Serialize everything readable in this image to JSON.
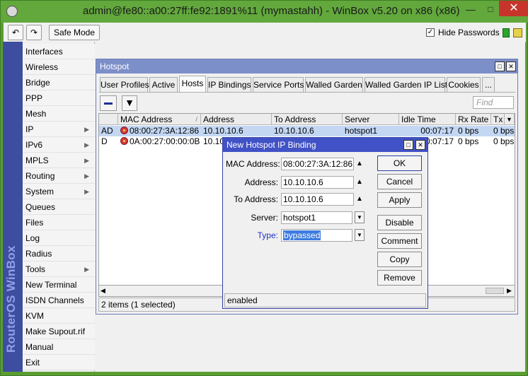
{
  "window": {
    "title": "admin@fe80::a00:27ff:fe92:1891%11 (mymastahh) - WinBox v5.20 on x86 (x86)",
    "minimize": "—",
    "maximize": "□",
    "close": "✕"
  },
  "toolbar": {
    "undo": "↶",
    "redo": "↷",
    "safe_mode": "Safe Mode",
    "hide_passwords_label": "Hide Passwords",
    "hide_passwords_checked": "✓"
  },
  "sidebar": {
    "brand": "RouterOS WinBox",
    "items": [
      {
        "label": "Interfaces",
        "arrow": ""
      },
      {
        "label": "Wireless",
        "arrow": ""
      },
      {
        "label": "Bridge",
        "arrow": ""
      },
      {
        "label": "PPP",
        "arrow": ""
      },
      {
        "label": "Mesh",
        "arrow": ""
      },
      {
        "label": "IP",
        "arrow": "▶"
      },
      {
        "label": "IPv6",
        "arrow": "▶"
      },
      {
        "label": "MPLS",
        "arrow": "▶"
      },
      {
        "label": "Routing",
        "arrow": "▶"
      },
      {
        "label": "System",
        "arrow": "▶"
      },
      {
        "label": "Queues",
        "arrow": ""
      },
      {
        "label": "Files",
        "arrow": ""
      },
      {
        "label": "Log",
        "arrow": ""
      },
      {
        "label": "Radius",
        "arrow": ""
      },
      {
        "label": "Tools",
        "arrow": "▶"
      },
      {
        "label": "New Terminal",
        "arrow": ""
      },
      {
        "label": "ISDN Channels",
        "arrow": ""
      },
      {
        "label": "KVM",
        "arrow": ""
      },
      {
        "label": "Make Supout.rif",
        "arrow": ""
      },
      {
        "label": "Manual",
        "arrow": ""
      },
      {
        "label": "Exit",
        "arrow": ""
      }
    ]
  },
  "hotspot": {
    "title": "Hotspot",
    "tabs": [
      "User Profiles",
      "Active",
      "Hosts",
      "IP Bindings",
      "Service Ports",
      "Walled Garden",
      "Walled Garden IP List",
      "Cookies",
      "..."
    ],
    "active_tab": "Hosts",
    "find_placeholder": "Find",
    "filter_icon": "▼",
    "columns": [
      "",
      "MAC Address",
      "Address",
      "To Address",
      "Server",
      "Idle Time",
      "Rx Rate",
      "Tx"
    ],
    "sort_indicator": "/",
    "column_menu": "▼",
    "rows": [
      {
        "flags": "AD",
        "mac": "08:00:27:3A:12:86",
        "address": "10.10.10.6",
        "to_address": "10.10.10.6",
        "server": "hotspot1",
        "idle": "00:07:17",
        "rx": "0 bps",
        "tx": "0 bps"
      },
      {
        "flags": "D",
        "mac": "0A:00:27:00:00:0B",
        "address": "10.10",
        "to_address": "",
        "server": "",
        "idle": "00:07:17",
        "rx": "0 bps",
        "tx": "0 bps"
      }
    ],
    "status": "2 items (1 selected)",
    "scroll_left": "◀",
    "scroll_right": "▶"
  },
  "dialog": {
    "title": "New Hotspot IP Binding",
    "fields": {
      "mac_label": "MAC Address:",
      "mac_value": "08:00:27:3A:12:86",
      "address_label": "Address:",
      "address_value": "10.10.10.6",
      "to_address_label": "To Address:",
      "to_address_value": "10.10.10.6",
      "server_label": "Server:",
      "server_value": "hotspot1",
      "type_label": "Type:",
      "type_value": "bypassed"
    },
    "up_arrow": "▲",
    "drop_arrow": "▼",
    "buttons": {
      "ok": "OK",
      "cancel": "Cancel",
      "apply": "Apply",
      "disable": "Disable",
      "comment": "Comment",
      "copy": "Copy",
      "remove": "Remove"
    },
    "status": "enabled"
  }
}
